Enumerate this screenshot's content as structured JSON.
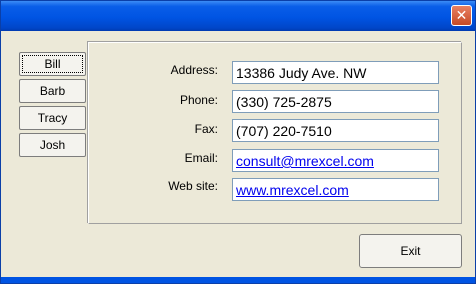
{
  "window": {
    "close_glyph": "✕"
  },
  "tabs": [
    {
      "label": "Bill",
      "active": true
    },
    {
      "label": "Barb",
      "active": false
    },
    {
      "label": "Tracy",
      "active": false
    },
    {
      "label": "Josh",
      "active": false
    }
  ],
  "fields": {
    "address": {
      "label": "Address:",
      "value": "13386 Judy Ave. NW"
    },
    "phone": {
      "label": "Phone:",
      "value": "(330) 725-2875"
    },
    "fax": {
      "label": "Fax:",
      "value": "(707) 220-7510"
    },
    "email": {
      "label": "Email:",
      "value": "consult@mrexcel.com"
    },
    "website": {
      "label": "Web site:",
      "value": "www.mrexcel.com"
    }
  },
  "buttons": {
    "exit_label": "Exit"
  },
  "colors": {
    "titlebar": "#0054e3",
    "face": "#ece9d8",
    "link": "#0000ee"
  }
}
